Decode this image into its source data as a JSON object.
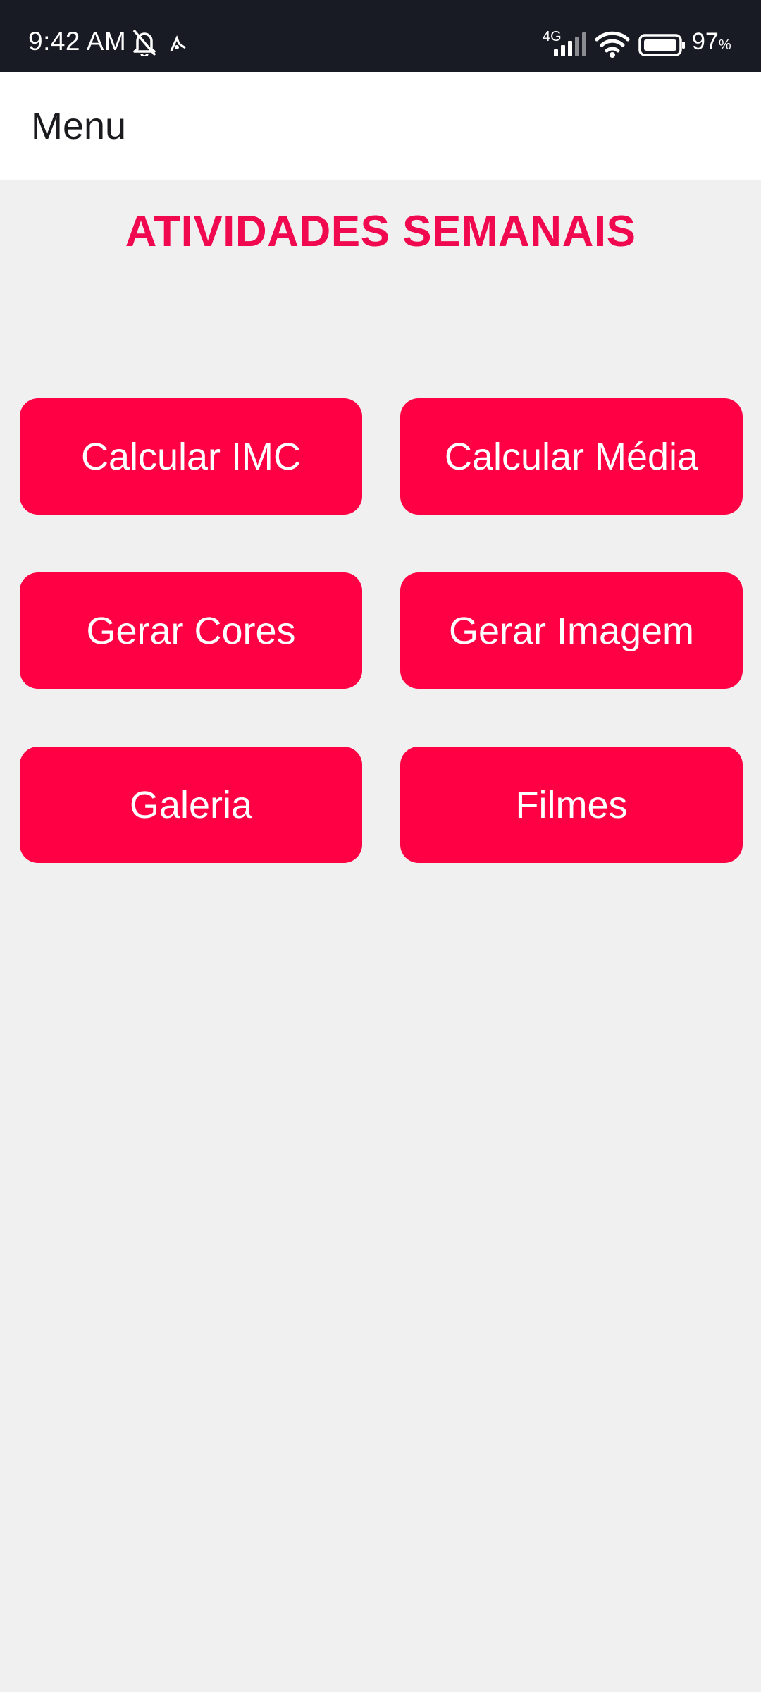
{
  "status_bar": {
    "time": "9:42 AM",
    "network_label": "4G",
    "battery_percent": "97",
    "battery_unit": "%",
    "icons": [
      "muted-bell-icon",
      "app-notification-icon",
      "cellular-signal-icon",
      "wifi-icon",
      "battery-icon"
    ]
  },
  "app_bar": {
    "title": "Menu"
  },
  "main": {
    "heading": "ATIVIDADES SEMANAIS",
    "buttons": [
      {
        "label": "Calcular IMC"
      },
      {
        "label": "Calcular Média"
      },
      {
        "label": "Gerar Cores"
      },
      {
        "label": "Gerar Imagem"
      },
      {
        "label": "Galeria"
      },
      {
        "label": "Filmes"
      }
    ]
  },
  "colors": {
    "status_bar_bg": "#181b23",
    "accent": "#fe0043",
    "heading": "#f0094f",
    "page_bg": "#f1f0f1",
    "app_bar_bg": "#ffffff"
  }
}
